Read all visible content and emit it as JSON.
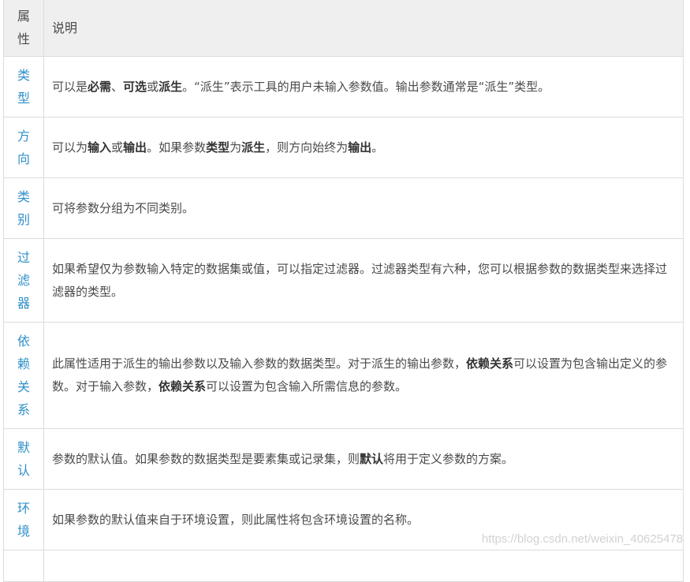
{
  "header": {
    "name": "属性",
    "desc": "说明"
  },
  "rows": [
    {
      "name": "类型",
      "desc": [
        {
          "t": "可以是"
        },
        {
          "t": "必需",
          "b": true
        },
        {
          "t": "、"
        },
        {
          "t": "可选",
          "b": true
        },
        {
          "t": "或"
        },
        {
          "t": "派生",
          "b": true
        },
        {
          "t": "。“派生”表示工具的用户未输入参数值。输出参数通常是“派生”类型。"
        }
      ]
    },
    {
      "name": "方向",
      "desc": [
        {
          "t": "可以为"
        },
        {
          "t": "输入",
          "b": true
        },
        {
          "t": "或"
        },
        {
          "t": "输出",
          "b": true
        },
        {
          "t": "。如果参数"
        },
        {
          "t": "类型",
          "b": true
        },
        {
          "t": "为"
        },
        {
          "t": "派生",
          "b": true
        },
        {
          "t": "，则方向始终为"
        },
        {
          "t": "输出",
          "b": true
        },
        {
          "t": "。"
        }
      ]
    },
    {
      "name": "类别",
      "desc": [
        {
          "t": "可将参数分组为不同类别。"
        }
      ]
    },
    {
      "name": "过滤器",
      "desc": [
        {
          "t": "如果希望仅为参数输入特定的数据集或值，可以指定过滤器。过滤器类型有六种，您可以根据参数的数据类型来选择过滤器的类型。"
        }
      ]
    },
    {
      "name": "依赖关系",
      "desc": [
        {
          "t": "此属性适用于派生的输出参数以及输入参数的数据类型。对于派生的输出参数，"
        },
        {
          "t": "依赖关系",
          "b": true
        },
        {
          "t": "可以设置为包含输出定义的参数。对于输入参数，"
        },
        {
          "t": "依赖关系",
          "b": true
        },
        {
          "t": "可以设置为包含输入所需信息的参数。"
        }
      ]
    },
    {
      "name": "默认",
      "desc": [
        {
          "t": "参数的默认值。如果参数的数据类型是要素集或记录集，则"
        },
        {
          "t": "默认",
          "b": true
        },
        {
          "t": "将用于定义参数的方案。"
        }
      ]
    },
    {
      "name": "环境",
      "desc": [
        {
          "t": "如果参数的默认值来自于环境设置，则此属性将包含环境设置的名称。"
        }
      ]
    }
  ],
  "watermark": "https://blog.csdn.net/weixin_40625478"
}
